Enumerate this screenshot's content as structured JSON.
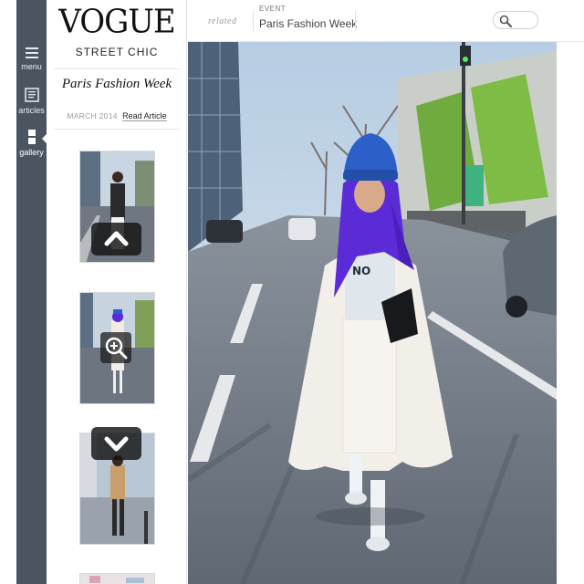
{
  "rail": {
    "items": [
      {
        "label": "menu",
        "icon": "hamburger-icon"
      },
      {
        "label": "articles",
        "icon": "document-icon"
      },
      {
        "label": "gallery",
        "icon": "gallery-icon"
      }
    ]
  },
  "panel": {
    "logo": "VOGUE",
    "section": "STREET CHIC",
    "article_title": "Paris Fashion Week",
    "article_date": "MARCH 2014",
    "read_link": "Read Article"
  },
  "topbar": {
    "related": "related",
    "event_label": "EVENT",
    "event_name": "Paris Fashion Week",
    "search_icon": "search-icon"
  },
  "controls": {
    "up": "chevron-up-icon",
    "zoom": "zoom-in-icon",
    "down": "chevron-down-icon"
  },
  "colors": {
    "rail": "#4b5562",
    "hair": "#5a2bd6",
    "beanie": "#2c5fc7",
    "coat": "#f2eee8"
  }
}
